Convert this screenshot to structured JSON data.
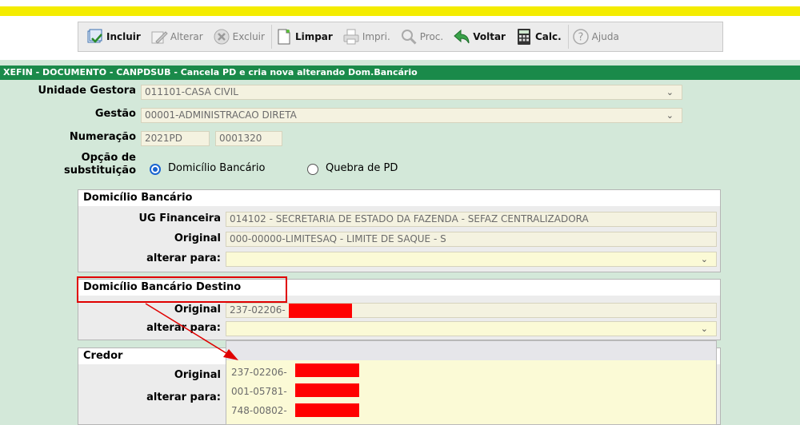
{
  "toolbar": {
    "incluir": "Incluir",
    "alterar": "Alterar",
    "excluir": "Excluir",
    "limpar": "Limpar",
    "imprimir": "Impri.",
    "proc": "Proc.",
    "voltar": "Voltar",
    "calc": "Calc.",
    "ajuda": "Ajuda"
  },
  "title": "XEFIN - DOCUMENTO - CANPDSUB - Cancela PD e cria nova alterando Dom.Bancário",
  "form": {
    "unidade_gestora_label": "Unidade Gestora",
    "unidade_gestora_value": "011101-CASA CIVIL",
    "gestao_label": "Gestão",
    "gestao_value": "00001-ADMINISTRACAO DIRETA",
    "numeracao_label": "Numeração",
    "numeracao_ano": "2021PD",
    "numeracao_num": "0001320",
    "opcao_label_1": "Opção de",
    "opcao_label_2": "substituição",
    "opcao_1": "Domicílio Bancário",
    "opcao_2": "Quebra de PD",
    "opcao_selected": "Domicílio Bancário"
  },
  "domicilio": {
    "title": "Domicílio Bancário",
    "ug_label": "UG Financeira",
    "ug_value": "014102 - SECRETARIA DE ESTADO DA FAZENDA - SEFAZ  CENTRALIZADORA",
    "original_label": "Original",
    "original_value": "000-00000-LIMITESAQ - LIMITE DE SAQUE - S",
    "alterar_label": "alterar para:",
    "alterar_value": ""
  },
  "destino": {
    "title": "Domicílio Bancário Destino",
    "original_label": "Original",
    "original_value": "237-02206-",
    "alterar_label": "alterar para:",
    "alterar_value": ""
  },
  "credor": {
    "title": "Credor",
    "original_label": "Original",
    "alterar_label": "alterar para:"
  },
  "dropdown_options": [
    "",
    "237-02206-",
    "001-05781-",
    "748-00802-"
  ],
  "colors": {
    "title_bar": "#1a8a4a",
    "highlight": "#e00000",
    "top_bar": "#f4ec00",
    "background": "#d3e8d9"
  }
}
